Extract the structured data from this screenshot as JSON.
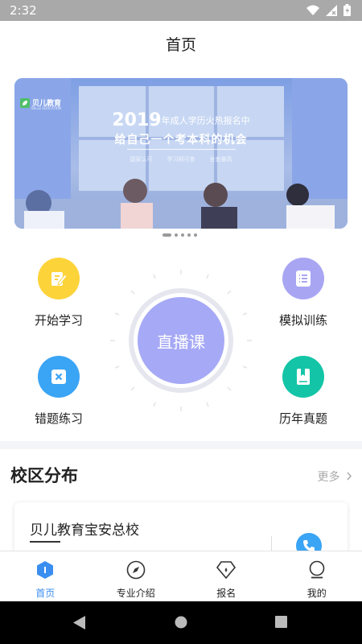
{
  "status_bar": {
    "time": "2:32"
  },
  "header": {
    "title": "首页"
  },
  "banner": {
    "logo_text": "贝儿教育",
    "logo_sub": "BELLE EDUCATION",
    "year": "2019",
    "line1": "年成人学历火热报名中",
    "line2": "给自己一个考本科的机会",
    "tags": [
      "国家认可",
      "学习网可查",
      "含金量高"
    ],
    "page_count": 5,
    "active_page": 0
  },
  "features": {
    "start_study": {
      "label": "开始学习",
      "color": "#fdd33a",
      "icon": "edit-icon"
    },
    "mock_training": {
      "label": "模拟训练",
      "color": "#a8a6f3",
      "icon": "list-icon"
    },
    "wrong_questions": {
      "label": "错题练习",
      "color": "#3aa4f5",
      "icon": "close-square-icon"
    },
    "past_papers": {
      "label": "历年真题",
      "color": "#13c5a6",
      "icon": "book-icon"
    },
    "live_class": {
      "label": "直播课",
      "color": "#a6a9f5"
    }
  },
  "campus": {
    "title": "校区分布",
    "more": "更多",
    "items": [
      {
        "name": "贝儿教育宝安总校"
      }
    ]
  },
  "tabs": [
    {
      "label": "首页",
      "icon": "home-hexagon-icon",
      "active": true
    },
    {
      "label": "专业介绍",
      "icon": "compass-icon",
      "active": false
    },
    {
      "label": "报名",
      "icon": "signup-diamond-icon",
      "active": false
    },
    {
      "label": "我的",
      "icon": "profile-icon",
      "active": false
    }
  ],
  "colors": {
    "accent": "#3a8ef0",
    "status_bar": "#a9a9a9",
    "section_gap": "#f4f5f9"
  }
}
